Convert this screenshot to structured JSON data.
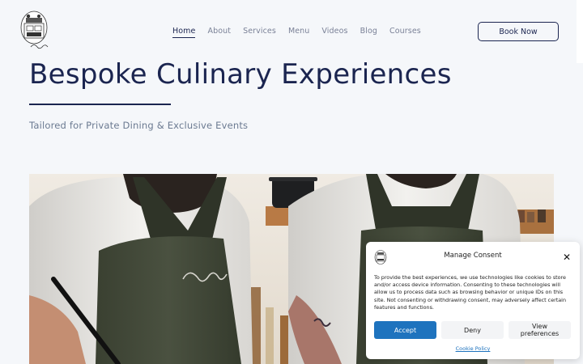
{
  "header": {
    "logo_icon": "chef-stove-logo-icon",
    "nav": [
      {
        "label": "Home",
        "active": true
      },
      {
        "label": "About"
      },
      {
        "label": "Services"
      },
      {
        "label": "Menu"
      },
      {
        "label": "Videos"
      },
      {
        "label": "Blog"
      },
      {
        "label": "Courses"
      }
    ],
    "book_label": "Book Now"
  },
  "hero": {
    "title": "Bespoke Culinary Experiences",
    "subtitle": "Tailored for Private Dining & Exclusive Events",
    "image": "two-chefs-in-aprons-photo"
  },
  "consent": {
    "title": "Manage Consent",
    "text": "To provide the best experiences, we use technologies like cookies to store and/or access device information. Consenting to these technologies will allow us to process data such as browsing behavior or unique IDs on this site. Not consenting or withdrawing consent, may adversely affect certain features and functions.",
    "accept_label": "Accept",
    "deny_label": "Deny",
    "prefs_label": "View preferences",
    "policy_label": "Cookie Policy",
    "close_icon": "close-icon"
  },
  "colors": {
    "brand": "#1b2550",
    "accent": "#1e73be",
    "background": "#f5f7fa"
  }
}
